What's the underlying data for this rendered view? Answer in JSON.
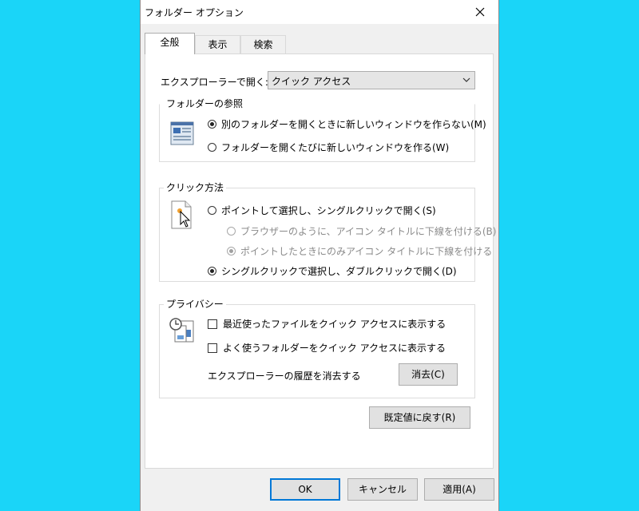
{
  "dialog": {
    "title": "フォルダー オプション"
  },
  "tabs": [
    {
      "label": "全般",
      "active": true
    },
    {
      "label": "表示",
      "active": false
    },
    {
      "label": "検索",
      "active": false
    }
  ],
  "general": {
    "open_explorer_label": "エクスプローラーで開く:",
    "open_explorer_value": "クイック アクセス",
    "browse_folders": {
      "title": "フォルダーの参照",
      "options": [
        {
          "label": "別のフォルダーを開くときに新しいウィンドウを作らない(M)",
          "selected": true
        },
        {
          "label": "フォルダーを開くたびに新しいウィンドウを作る(W)",
          "selected": false
        }
      ]
    },
    "click_items": {
      "title": "クリック方法",
      "options": [
        {
          "label": "ポイントして選択し、シングルクリックで開く(S)",
          "selected": false,
          "enabled": true
        },
        {
          "label": "ブラウザーのように、アイコン タイトルに下線を付ける(B)",
          "selected": false,
          "enabled": false
        },
        {
          "label": "ポイントしたときにのみアイコン タイトルに下線を付ける",
          "selected": true,
          "enabled": false
        },
        {
          "label": "シングルクリックで選択し、ダブルクリックで開く(D)",
          "selected": true,
          "enabled": true
        }
      ]
    },
    "privacy": {
      "title": "プライバシー",
      "checks": [
        {
          "label": "最近使ったファイルをクイック アクセスに表示する",
          "checked": false
        },
        {
          "label": "よく使うフォルダーをクイック アクセスに表示する",
          "checked": false
        }
      ],
      "clear_label": "エクスプローラーの履歴を消去する",
      "clear_button": "消去(C)"
    },
    "restore_defaults": "既定値に戻す(R)"
  },
  "footer": {
    "ok": "OK",
    "cancel": "キャンセル",
    "apply": "適用(A)"
  },
  "colors": {
    "background": "#1ad5f8",
    "accent": "#0078d7"
  }
}
